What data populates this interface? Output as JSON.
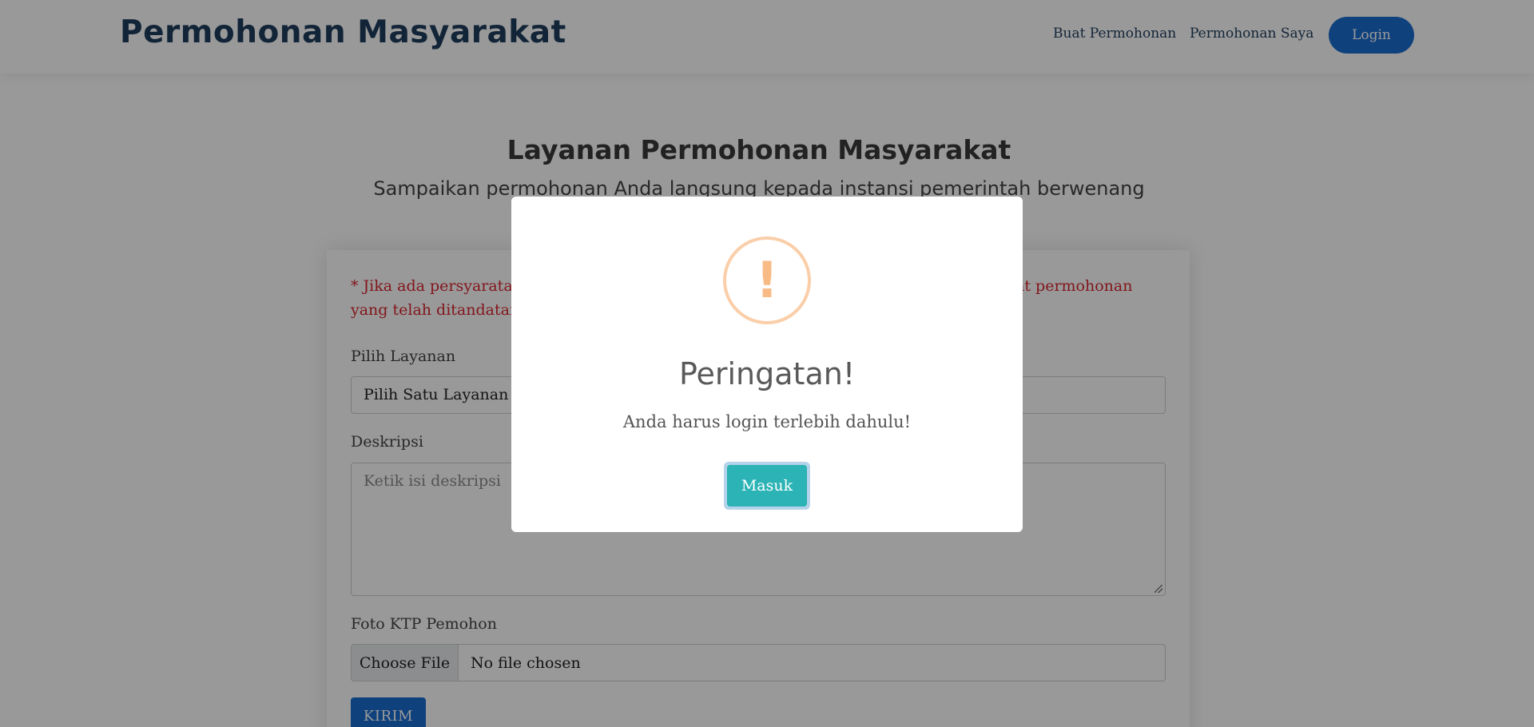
{
  "header": {
    "brand": "Permohonan Masyarakat",
    "nav": {
      "buat": "Buat Permohonan",
      "saya": "Permohonan Saya",
      "login": "Login"
    }
  },
  "hero": {
    "title": "Layanan Permohonan Masyarakat",
    "subtitle": "Sampaikan permohonan Anda langsung kepada instansi pemerintah berwenang"
  },
  "form": {
    "notice": "* Jika ada persyaratan yang diperlukan, silakan unggah dokumen persyaratan dan surat permohonan yang telah ditandatangani.",
    "layanan_label": "Pilih Layanan",
    "layanan_value": "Pilih Satu Layanan",
    "deskripsi_label": "Deskripsi",
    "deskripsi_placeholder": "Ketik isi deskripsi",
    "ktp_label": "Foto KTP Pemohon",
    "file_button": "Choose File",
    "file_status": "No file chosen",
    "submit": "KIRIM"
  },
  "modal": {
    "icon": "!",
    "icon_name": "warning-icon",
    "title": "Peringatan!",
    "text": "Anda harus login terlebih dahulu!",
    "button": "Masuk"
  },
  "colors": {
    "primary": "#1a6dd1",
    "brand_text": "#1e3d5c",
    "notice_red": "#d9262f",
    "modal_button": "#2bb3b5",
    "warning": "#f8bb86"
  }
}
